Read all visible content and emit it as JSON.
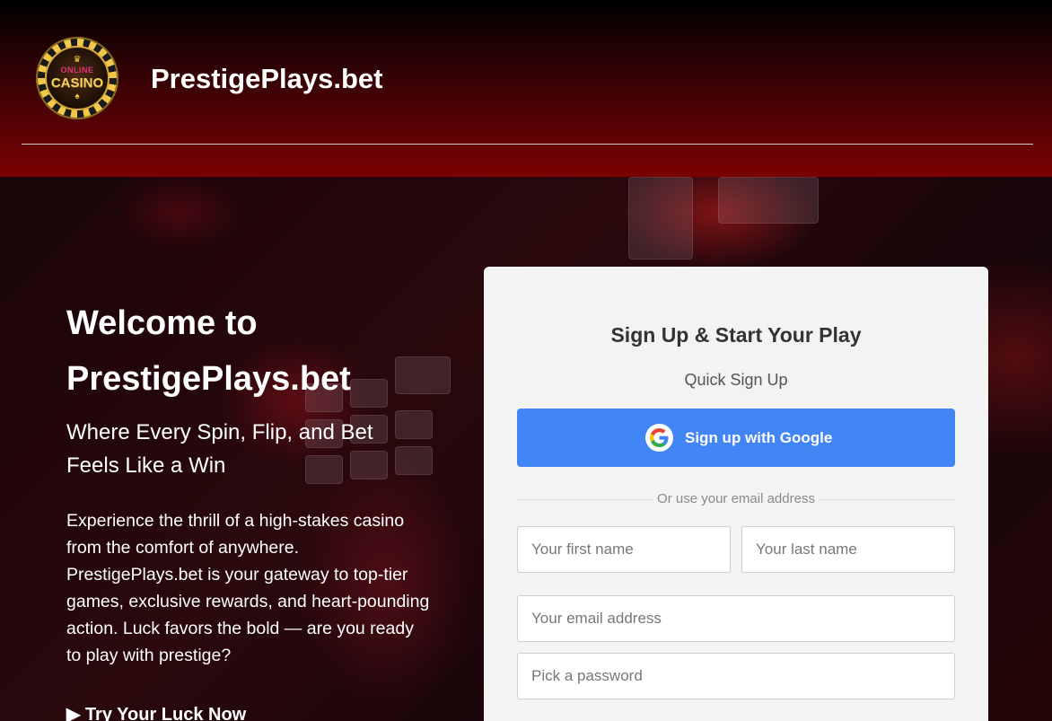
{
  "header": {
    "brand": "PrestigePlays.bet",
    "logo": {
      "top_text": "ONLINE",
      "main_text": "CASINO"
    }
  },
  "hero": {
    "title_line1": "Welcome to",
    "title_line2": "PrestigePlays.bet",
    "subtitle": "Where Every Spin, Flip, and Bet Feels Like a Win",
    "description": "Experience the thrill of a high-stakes casino from the comfort of anywhere. PrestigePlays.bet is your gateway to top-tier games, exclusive rewards, and heart-pounding action. Luck favors the bold — are you ready to play with prestige?",
    "cta": "▶ Try Your Luck Now"
  },
  "signup": {
    "title": "Sign Up & Start Your Play",
    "subtitle": "Quick Sign Up",
    "google_button": "Sign up with Google",
    "divider": "Or use your email address",
    "first_name_placeholder": "Your first name",
    "last_name_placeholder": "Your last name",
    "email_placeholder": "Your email address",
    "password_placeholder": "Pick a password"
  },
  "icons": {
    "google": "google-g-icon",
    "logo": "casino-chip-logo"
  },
  "colors": {
    "header_red": "#7a0202",
    "google_blue": "#4285f4",
    "card_bg": "#f3f3f3"
  }
}
